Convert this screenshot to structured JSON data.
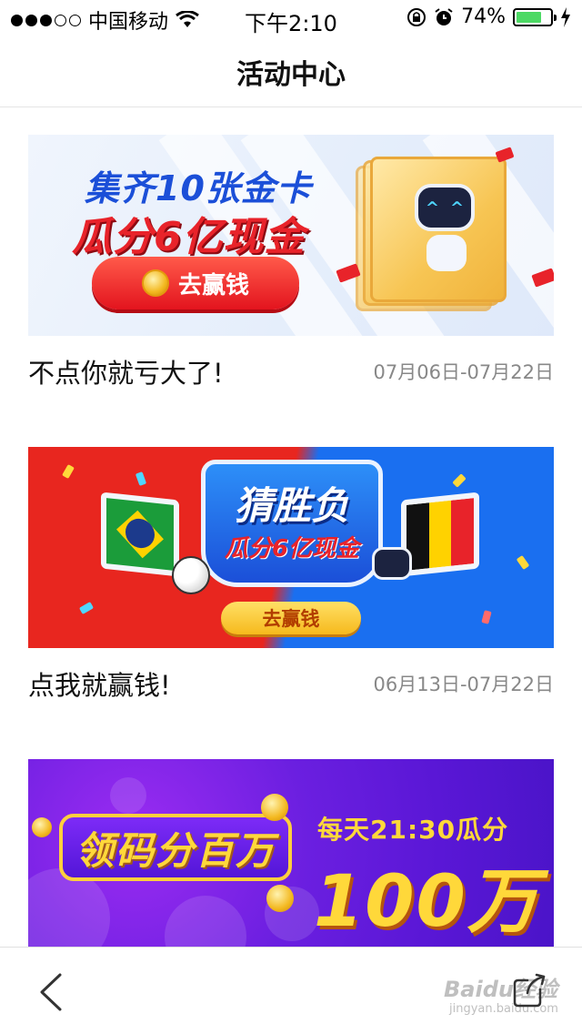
{
  "status_bar": {
    "carrier": "中国移动",
    "time": "下午2:10",
    "battery_percent": "74%",
    "battery_level": 0.74,
    "signal_icon": "signal-dots-icon",
    "wifi_icon": "wifi-icon",
    "lock_icon": "rotation-lock-icon",
    "alarm_icon": "alarm-icon",
    "charging_icon": "charging-bolt-icon"
  },
  "nav": {
    "title": "活动中心"
  },
  "activities": [
    {
      "banner_line1": "集齐10张金卡",
      "banner_line2": "瓜分6亿现金",
      "banner_cta": "去赢钱",
      "title": "不点你就亏大了!",
      "date_range": "07月06日-07月22日"
    },
    {
      "banner_line1": "猜胜负",
      "banner_line2": "瓜分6亿现金",
      "banner_cta": "去赢钱",
      "title": "点我就赢钱!",
      "date_range": "06月13日-07月22日"
    },
    {
      "banner_line1": "领码分百万",
      "banner_line2": "每天21:30瓜分",
      "banner_line3": "100万"
    }
  ],
  "toolbar": {
    "back_icon": "chevron-left-icon",
    "share_icon": "share-icon"
  },
  "watermark": {
    "brand": "Baidu经验",
    "url": "jingyan.baidu.com"
  },
  "colors": {
    "accent_red": "#e8232a",
    "accent_blue": "#1b4fd8",
    "gold": "#ffd83a",
    "date_gray": "#888888",
    "battery_green": "#4cd964"
  }
}
